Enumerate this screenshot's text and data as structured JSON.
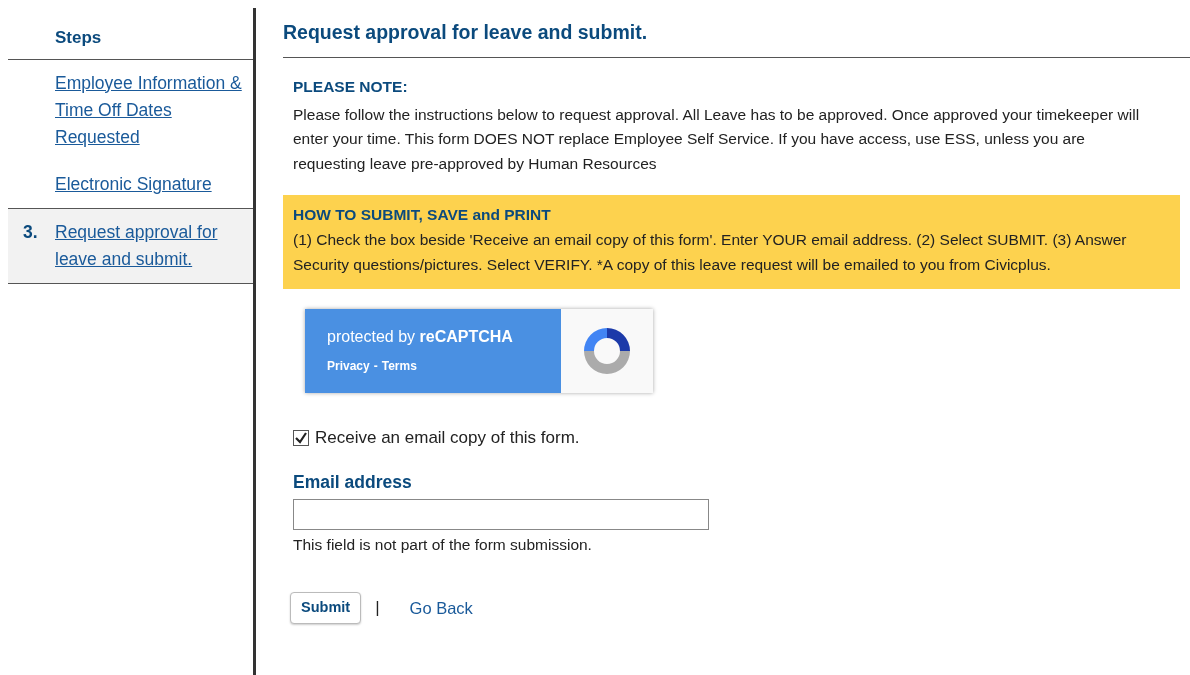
{
  "sidebar": {
    "title": "Steps",
    "items": [
      {
        "label": "Employee Information & Time Off Dates Requested",
        "selected": false
      },
      {
        "label": "Electronic Signature",
        "selected": false
      },
      {
        "number": "3.",
        "label": "Request approval for leave and submit.",
        "selected": true
      }
    ]
  },
  "page_title": "Request approval for leave and submit.",
  "note": {
    "heading": "PLEASE NOTE:",
    "text": "Please follow the instructions below to request approval. All Leave has to be approved. Once approved your timekeeper will enter your time. This form DOES NOT replace Employee Self Service. If you have access, use ESS, unless you are requesting leave pre-approved by Human Resources"
  },
  "howto": {
    "heading": "HOW TO SUBMIT, SAVE and PRINT",
    "text": "(1) Check the box beside 'Receive an email copy of this form'. Enter YOUR email address. (2) Select SUBMIT. (3) Answer Security questions/pictures. Select VERIFY. *A copy of this leave request will be emailed to you from Civicplus."
  },
  "captcha": {
    "label": "protected by **reCAPTCHA**",
    "privacy": "Privacy",
    "separator": "-",
    "terms": "Terms"
  },
  "email_copy": {
    "label": "Receive an email copy of this form.",
    "checked": true
  },
  "email": {
    "label": "Email address",
    "hint": "This field is not part of the form submission."
  },
  "actions": {
    "submit": "Submit",
    "divider": "|",
    "back": "Go Back"
  }
}
